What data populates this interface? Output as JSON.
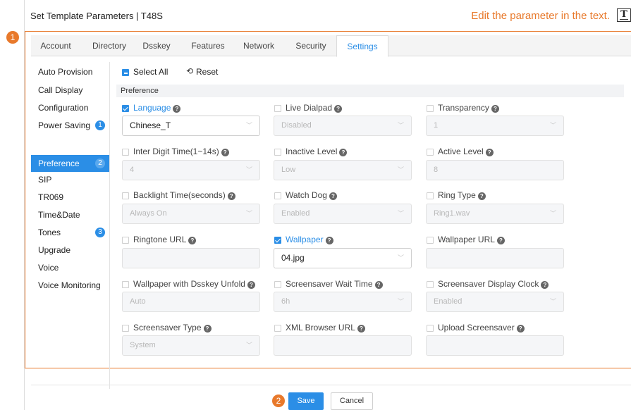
{
  "title": "Set Template Parameters | T48S",
  "hint": {
    "text": "Edit the parameter in the text.",
    "icon": "text-T-icon",
    "icon_glyph": "T"
  },
  "steps": [
    "1",
    "2"
  ],
  "tabs": [
    {
      "label": "Account",
      "active": false
    },
    {
      "label": "Directory",
      "active": false
    },
    {
      "label": "Dsskey",
      "active": false
    },
    {
      "label": "Features",
      "active": false
    },
    {
      "label": "Network",
      "active": false
    },
    {
      "label": "Security",
      "active": false
    },
    {
      "label": "Settings",
      "active": true
    }
  ],
  "sidebar": {
    "items": [
      {
        "label": "Auto Provision",
        "badge": ""
      },
      {
        "label": "Call Display",
        "badge": ""
      },
      {
        "label": "Configuration",
        "badge": ""
      },
      {
        "label": "Power Saving",
        "badge": "1"
      },
      {
        "label": "Preference",
        "badge": "2",
        "active": true
      },
      {
        "label": "SIP",
        "badge": ""
      },
      {
        "label": "TR069",
        "badge": ""
      },
      {
        "label": "Time&Date",
        "badge": ""
      },
      {
        "label": "Tones",
        "badge": "3"
      },
      {
        "label": "Upgrade",
        "badge": ""
      },
      {
        "label": "Voice",
        "badge": ""
      },
      {
        "label": "Voice Monitoring",
        "badge": ""
      }
    ]
  },
  "toolbar": {
    "select_all": "Select All",
    "reset": "Reset"
  },
  "section": {
    "title": "Preference"
  },
  "help_glyph": "?",
  "chevron_glyph": "﹀",
  "fields": [
    {
      "label": "Language",
      "value": "Chinese_T",
      "checked": true,
      "type": "select"
    },
    {
      "label": "Live Dialpad",
      "value": "Disabled",
      "checked": false,
      "type": "select"
    },
    {
      "label": "Transparency",
      "value": "1",
      "checked": false,
      "type": "select"
    },
    {
      "label": "Inter Digit Time(1~14s)",
      "value": "4",
      "checked": false,
      "type": "select"
    },
    {
      "label": "Inactive Level",
      "value": "Low",
      "checked": false,
      "type": "select"
    },
    {
      "label": "Active Level",
      "value": "8",
      "checked": false,
      "type": "text"
    },
    {
      "label": "Backlight Time(seconds)",
      "value": "Always On",
      "checked": false,
      "type": "select"
    },
    {
      "label": "Watch Dog",
      "value": "Enabled",
      "checked": false,
      "type": "select"
    },
    {
      "label": "Ring Type",
      "value": "Ring1.wav",
      "checked": false,
      "type": "select"
    },
    {
      "label": "Ringtone URL",
      "value": "",
      "checked": false,
      "type": "text"
    },
    {
      "label": "Wallpaper",
      "value": "04.jpg",
      "checked": true,
      "type": "select"
    },
    {
      "label": "Wallpaper URL",
      "value": "",
      "checked": false,
      "type": "text"
    },
    {
      "label": "Wallpaper with Dsskey Unfold",
      "value": "Auto",
      "checked": false,
      "type": "text"
    },
    {
      "label": "Screensaver Wait Time",
      "value": "6h",
      "checked": false,
      "type": "select"
    },
    {
      "label": "Screensaver Display Clock",
      "value": "Enabled",
      "checked": false,
      "type": "select"
    },
    {
      "label": "Screensaver Type",
      "value": "System",
      "checked": false,
      "type": "select"
    },
    {
      "label": "XML Browser URL",
      "value": "",
      "checked": false,
      "type": "text"
    },
    {
      "label": "Upload Screensaver",
      "value": "",
      "checked": false,
      "type": "text"
    }
  ],
  "buttons": {
    "save": "Save",
    "cancel": "Cancel"
  },
  "colors": {
    "accent": "#2b8ee6",
    "highlight": "#e8792b"
  }
}
